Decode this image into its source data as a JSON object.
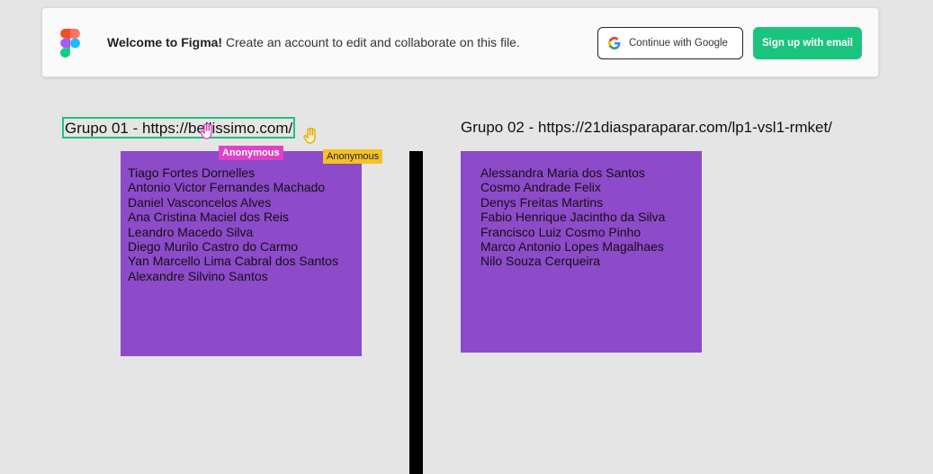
{
  "banner": {
    "welcome_bold": "Welcome to Figma!",
    "welcome_rest": " Create an account to edit and collaborate on this file.",
    "google_button": "Continue with Google",
    "email_button": "Sign up with email"
  },
  "groups": [
    {
      "title": "Grupo 01 - https://bellissimo.com/",
      "members": [
        "Tiago Fortes Dornelles",
        "Antonio Victor Fernandes Machado",
        "Daniel Vasconcelos Alves",
        "Ana Cristina Maciel dos Reis",
        "Leandro Macedo Silva",
        "Diego Murilo Castro do Carmo",
        "Yan Marcello Lima Cabral dos Santos",
        "Alexandre Silvino Santos"
      ]
    },
    {
      "title": "Grupo 02 - https://21diasparaparar.com/lp1-vsl1-rmket/",
      "members": [
        "Alessandra Maria dos Santos",
        "Cosmo Andrade Felix",
        "Denys Freitas Martins",
        "Fabio Henrique Jacintho da Silva",
        "Francisco Luiz Cosmo Pinho",
        "Marco Antonio Lopes Magalhaes",
        "Nilo Souza Cerqueira"
      ]
    }
  ],
  "cursors": [
    {
      "label": "Anonymous",
      "color": "#e041c6"
    },
    {
      "label": "Anonymous",
      "color": "#f5c222"
    }
  ],
  "colors": {
    "sticky": "#8d4ac9",
    "accent_green": "#1bc47d",
    "canvas": "#e5e5e5"
  }
}
